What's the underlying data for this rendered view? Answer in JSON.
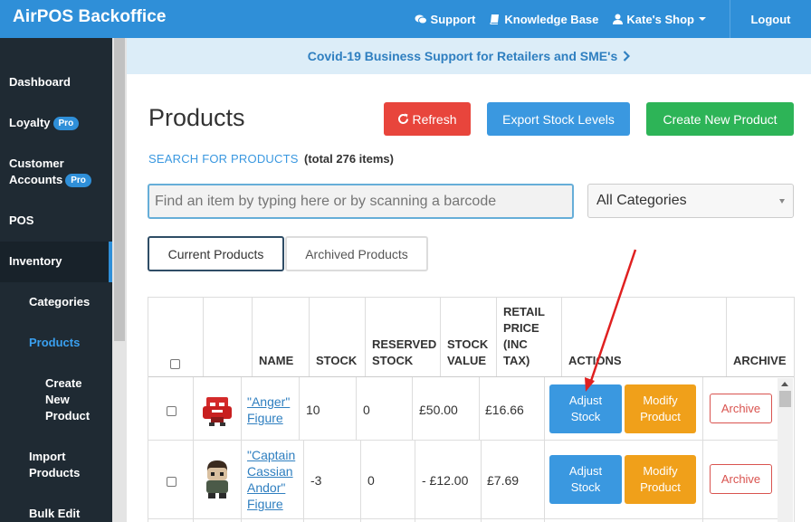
{
  "app": {
    "brand": "AirPOS Backoffice",
    "nav": {
      "support": "Support",
      "knowledge_base": "Knowledge Base",
      "shop": "Kate's Shop",
      "logout": "Logout"
    }
  },
  "sidebar": {
    "dashboard": "Dashboard",
    "loyalty": "Loyalty",
    "customer_accounts_1": "Customer",
    "customer_accounts_2": "Accounts",
    "pro_badge": "Pro",
    "pos": "POS",
    "inventory": "Inventory",
    "categories": "Categories",
    "products": "Products",
    "create_1": "Create",
    "create_2": "New",
    "create_3": "Product",
    "import_1": "Import",
    "import_2": "Products",
    "bulk_edit": "Bulk Edit"
  },
  "banner": {
    "text": "Covid-19 Business Support for Retailers and SME's"
  },
  "page": {
    "title": "Products",
    "refresh": "Refresh",
    "export": "Export Stock Levels",
    "create": "Create New Product",
    "search_label": "SEARCH FOR PRODUCTS",
    "total": "(total 276 items)",
    "search_placeholder": "Find an item by typing here or by scanning a barcode",
    "category_selected": "All Categories",
    "tab_current": "Current Products",
    "tab_archived": "Archived Products"
  },
  "table": {
    "headers": {
      "name": "NAME",
      "stock": "STOCK",
      "reserved_1": "RESERVED",
      "reserved_2": "STOCK",
      "value_1": "STOCK",
      "value_2": "VALUE",
      "retail_1": "RETAIL",
      "retail_2": "PRICE",
      "retail_3": "(INC",
      "retail_4": "TAX)",
      "actions": "ACTIONS",
      "archive": "ARCHIVE"
    },
    "rows": [
      {
        "name_lines": [
          "\"Anger\"",
          "Figure"
        ],
        "stock": "10",
        "reserved": "0",
        "value": "£50.00",
        "retail": "£16.66",
        "adjust_1": "Adjust",
        "adjust_2": "Stock",
        "modify_1": "Modify",
        "modify_2": "Product",
        "archive": "Archive"
      },
      {
        "name_lines": [
          "\"Captain",
          "Cassian",
          "Andor\"",
          "Figure"
        ],
        "stock": "-3",
        "reserved": "0",
        "value": "- £12.00",
        "retail": "£7.69",
        "adjust_1": "Adjust",
        "adjust_2": "Stock",
        "modify_1": "Modify",
        "modify_2": "Product",
        "archive": "Archive"
      }
    ]
  },
  "colors": {
    "topbar": "#2f8fd8",
    "sidebar": "#1f2a33",
    "refresh": "#e8453c",
    "export": "#3a98e0",
    "create": "#2db457",
    "modify": "#f0a01a",
    "annotation_arrow": "#e02020"
  },
  "icons": {
    "support": "chat-bubbles-icon",
    "knowledge_base": "book-icon",
    "shop": "user-icon",
    "refresh": "refresh-icon",
    "banner": "chevron-right-icon"
  }
}
